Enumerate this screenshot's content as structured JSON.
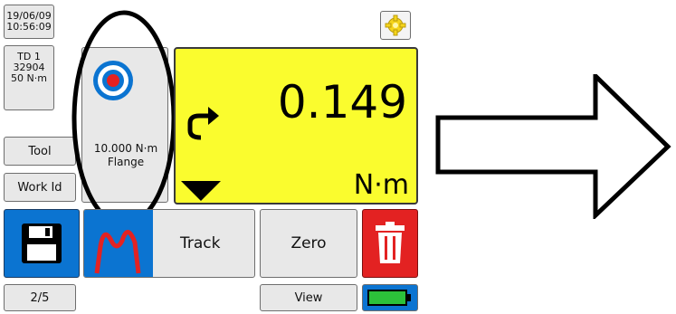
{
  "status": {
    "date": "19/06/09",
    "time": "10:56:09"
  },
  "transducer": {
    "line1": "TD 1",
    "line2": "32904",
    "line3": "50 N·m"
  },
  "buttons": {
    "tool": "Tool",
    "work_id": "Work Id",
    "track": "Track",
    "zero": "Zero",
    "view": "View",
    "page": "2/5"
  },
  "mode": {
    "value": "10.000 N·m",
    "type": "Flange"
  },
  "display": {
    "reading": "0.149",
    "unit": "N·m"
  },
  "icons": {
    "settings": "gear-icon",
    "target": "target-icon",
    "direction": "direction-arrow-icon",
    "indicator": "down-triangle-icon",
    "save": "floppy-disk-icon",
    "graph": "graph-peaks-icon",
    "delete": "trash-icon",
    "battery": "battery-icon",
    "next": "right-arrow-icon"
  },
  "colors": {
    "display_bg": "#fafc2e",
    "save_bg": "#0b74d1",
    "delete_bg": "#e32222",
    "graph_bg": "#0b74d1",
    "battery_fill": "#2cc13a",
    "gear": "#f6d51a"
  }
}
